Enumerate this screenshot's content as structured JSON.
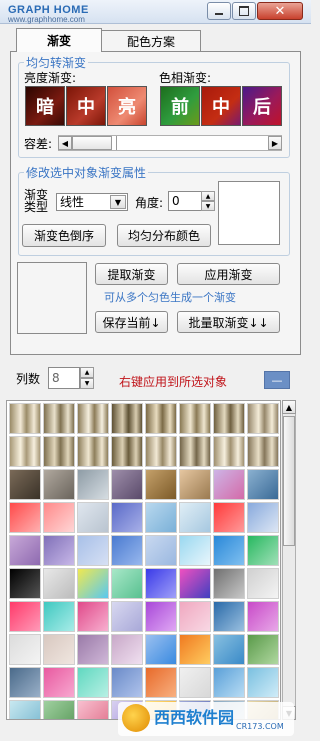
{
  "titlebar": {
    "logo": "GRAPH HOME",
    "logo_sub": "www.graphhome.com",
    "minimize_icon": "minimize-icon",
    "maximize_icon": "maximize-icon",
    "close_icon": "close-icon"
  },
  "tabs": [
    {
      "label": "渐变",
      "active": true
    },
    {
      "label": "配色方案",
      "active": false
    }
  ],
  "uniform": {
    "title": "均匀转渐变",
    "brightness_label": "亮度渐变:",
    "hue_label": "色相渐变:",
    "brightness_buttons": [
      "暗",
      "中",
      "亮"
    ],
    "hue_buttons": [
      "前",
      "中",
      "后"
    ],
    "tolerance_label": "容差:"
  },
  "modify": {
    "title": "修改选中对象渐变属性",
    "type_label_line1": "渐变",
    "type_label_line2": "类型",
    "type_value": "线性",
    "angle_label": "角度:",
    "angle_value": "0",
    "reverse_button": "渐变色倒序",
    "distribute_button": "均匀分布颜色"
  },
  "actions": {
    "extract_button": "提取渐变",
    "apply_button": "应用渐变",
    "hint": "可从多个匀色生成一个渐变",
    "save_button": "保存当前↓",
    "batch_button": "批量取渐变↓↓"
  },
  "bottom": {
    "columns_label": "列数",
    "columns_value": "8",
    "right_click_hint": "右键应用到所选对象",
    "collapse_label": "—"
  },
  "watermark": {
    "text": "西西软件园",
    "sub": "CR173.COM"
  }
}
